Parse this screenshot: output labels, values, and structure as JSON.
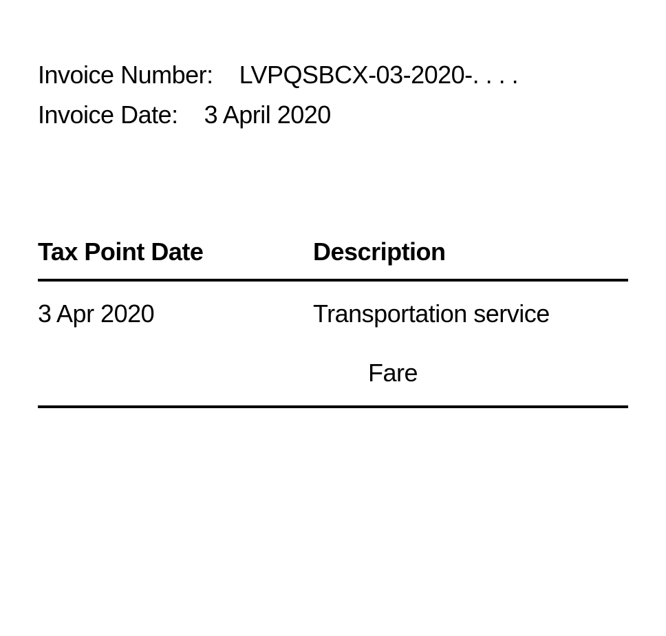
{
  "meta": {
    "invoice_number_label": "Invoice Number:",
    "invoice_number_value": "LVPQSBCX-03-2020-. . . .",
    "invoice_date_label": "Invoice Date:",
    "invoice_date_value": "3 April 2020"
  },
  "table": {
    "headers": {
      "tax_point_date": "Tax Point Date",
      "description": "Description"
    },
    "rows": [
      {
        "tax_point_date": "3 Apr 2020",
        "description": "Transportation service",
        "sub_description": "Fare"
      }
    ]
  }
}
